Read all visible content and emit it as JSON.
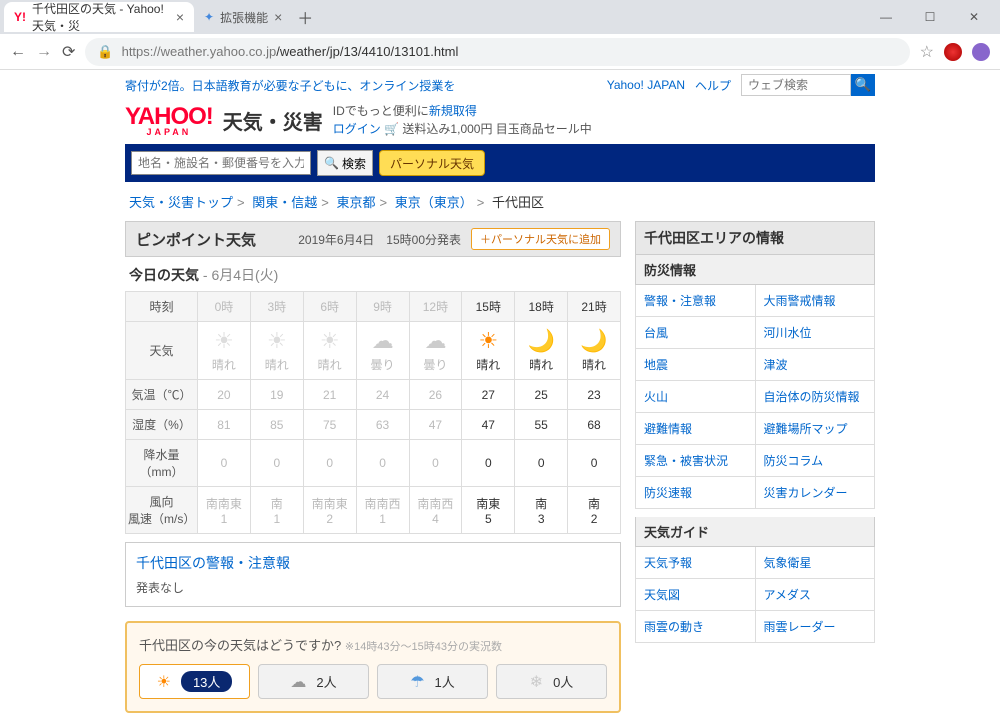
{
  "browser": {
    "tabs": [
      {
        "title": "千代田区の天気 - Yahoo!天気・災",
        "active": true
      },
      {
        "title": "拡張機能",
        "active": false
      }
    ],
    "url_host": "https://weather.yahoo.co.jp",
    "url_path": "/weather/jp/13/4410/13101.html"
  },
  "topbar": {
    "promo": "寄付が2倍。日本語教育が必要な子どもに、オンライン授業を",
    "yj_link": "Yahoo! JAPAN",
    "help": "ヘルプ",
    "websearch_placeholder": "ウェブ検索"
  },
  "header": {
    "logo_text": "YAHOO!",
    "logo_sub": "JAPAN",
    "service": "天気・災害",
    "line1_a": "IDでもっと便利に",
    "line1_b": "新規取得",
    "line2_login": "ログイン",
    "line2_rest": "🛒 送料込み1,000円 目玉商品セール中"
  },
  "searchbar": {
    "placeholder": "地名・施設名・郵便番号を入力",
    "btn": "検索",
    "personal": "パーソナル天気"
  },
  "breadcrumb": {
    "items": [
      "天気・災害トップ",
      "関東・信越",
      "東京都",
      "東京（東京）"
    ],
    "current": "千代田区"
  },
  "pinpoint": {
    "title": "ピンポイント天気",
    "date": "2019年6月4日",
    "issued": "15時00分発表",
    "add_btn": "＋パーソナル天気に追加"
  },
  "today": {
    "label": "今日の天気",
    "date": " - 6月4日(火)"
  },
  "table": {
    "rows": [
      "時刻",
      "天気",
      "気温（℃）",
      "湿度（%）",
      "降水量（mm）",
      "風向\n風速（m/s）"
    ],
    "hours": [
      "0時",
      "3時",
      "6時",
      "9時",
      "12時",
      "15時",
      "18時",
      "21時"
    ],
    "past_cutoff": 5,
    "weather_label": [
      "晴れ",
      "晴れ",
      "晴れ",
      "曇り",
      "曇り",
      "晴れ",
      "晴れ",
      "晴れ"
    ],
    "weather_icon": [
      "sun",
      "sun",
      "sun",
      "cloud",
      "cloud",
      "sun",
      "moon",
      "moon"
    ],
    "temp": [
      "20",
      "19",
      "21",
      "24",
      "26",
      "27",
      "25",
      "23"
    ],
    "humid": [
      "81",
      "85",
      "75",
      "63",
      "47",
      "47",
      "55",
      "68"
    ],
    "precip": [
      "0",
      "0",
      "0",
      "0",
      "0",
      "0",
      "0",
      "0"
    ],
    "wind_dir": [
      "南南東",
      "南",
      "南南東",
      "南南西",
      "南南西",
      "南東",
      "南",
      "南"
    ],
    "wind_spd": [
      "1",
      "1",
      "2",
      "1",
      "4",
      "5",
      "3",
      "2"
    ]
  },
  "warn": {
    "link": "千代田区の警報・注意報",
    "none": "発表なし"
  },
  "feedback": {
    "title": "千代田区の今の天気はどうですか?",
    "sub": "※14時43分～15時43分の実況数",
    "opts": [
      {
        "icon": "☀",
        "count": "13人",
        "sel": true,
        "color": "#ff8800"
      },
      {
        "icon": "☁",
        "count": "2人",
        "sel": false,
        "color": "#999"
      },
      {
        "icon": "☂",
        "count": "1人",
        "sel": false,
        "color": "#5599dd"
      },
      {
        "icon": "❄",
        "count": "0人",
        "sel": false,
        "color": "#ccc"
      }
    ]
  },
  "side": {
    "area_title": "千代田区エリアの情報",
    "sec1": {
      "title": "防災情報",
      "links": [
        "警報・注意報",
        "大雨警戒情報",
        "台風",
        "河川水位",
        "地震",
        "津波",
        "火山",
        "自治体の防災情報",
        "避難情報",
        "避難場所マップ",
        "緊急・被害状況",
        "防災コラム",
        "防災速報",
        "災害カレンダー"
      ]
    },
    "sec2": {
      "title": "天気ガイド",
      "links": [
        "天気予報",
        "気象衛星",
        "天気図",
        "アメダス",
        "雨雲の動き",
        "雨雲レーダー"
      ]
    }
  }
}
